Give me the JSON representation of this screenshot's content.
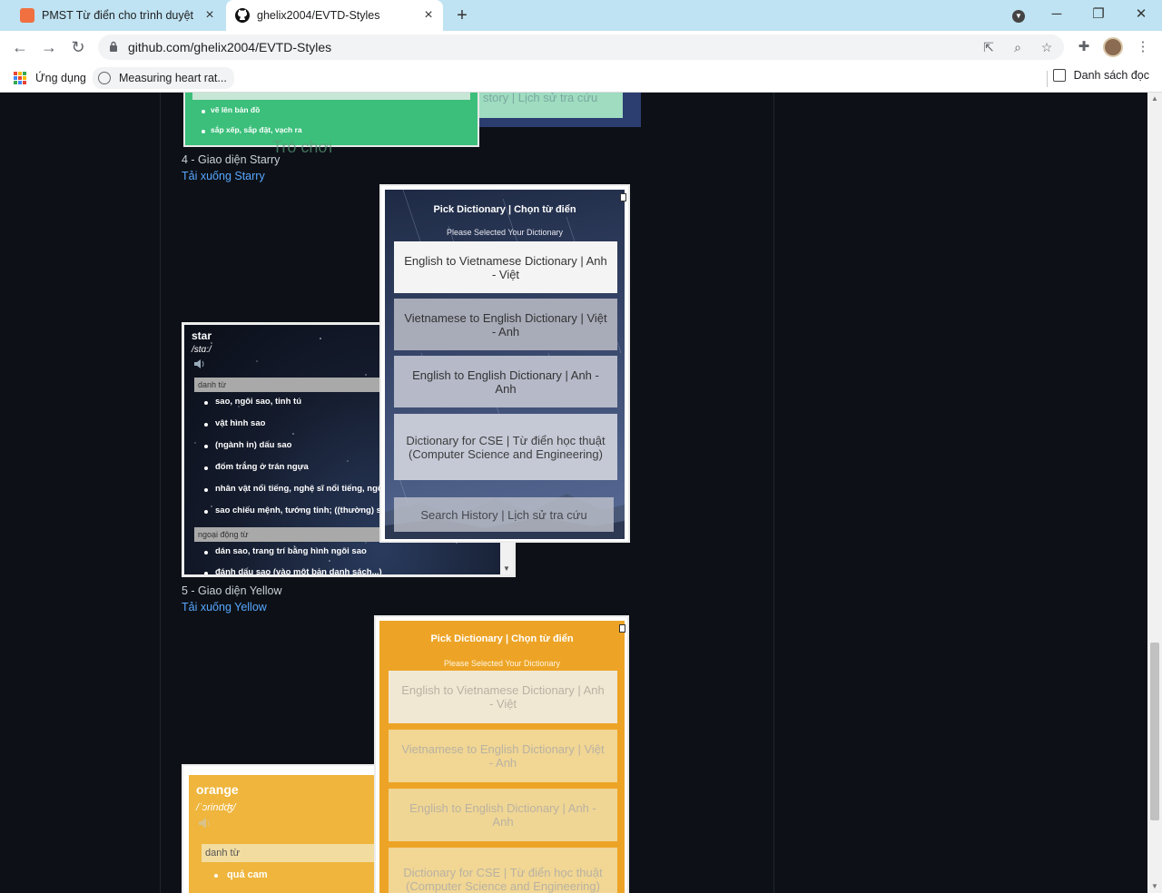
{
  "browser": {
    "tabs": [
      {
        "title": "PMST Từ điển cho trình duyệt"
      },
      {
        "title": "ghelix2004/EVTD-Styles"
      }
    ],
    "url": "github.com/ghelix2004/EVTD-Styles",
    "bookmarks": [
      {
        "label": "Ứng dụng"
      },
      {
        "label": "Measuring heart rat..."
      }
    ],
    "reading_list": "Danh sách đọc"
  },
  "green_preview": {
    "items": [
      "vẽ lên bản đồ",
      "sắp xếp, sắp đặt, vạch ra"
    ],
    "faded_text": "Trò chơi",
    "back_text": "story | Lịch sử tra cứu"
  },
  "sections": [
    {
      "heading": "4 - Giao diện Starry",
      "link": "Tải xuống Starry"
    },
    {
      "heading": "5 - Giao diện Yellow",
      "link": "Tải xuống Yellow"
    }
  ],
  "starry": {
    "word": {
      "word": "star",
      "pron": "/stɑ:/",
      "pos1": "danh từ",
      "items1": [
        "sao, ngôi sao, tinh tú",
        "vật hình sao",
        "(ngành in) dấu sao",
        "đốm trắng ở trán ngựa",
        "nhân vật nổi tiếng, nghệ sĩ nổi tiếng, ngô",
        "sao chiếu mệnh, tướng tinh; ((thường) số"
      ],
      "pos2": "ngoại động từ",
      "items2": [
        "dán sao, trang trí bằng hình ngôi sao",
        "đánh dấu sao (vào một bản danh sách...)"
      ]
    },
    "pick": {
      "title": "Pick Dictionary | Chọn từ điển",
      "subtitle": "Please Selected Your Dictionary",
      "options": [
        "English to Vietnamese Dictionary | Anh - Việt",
        "Vietnamese to English Dictionary | Việt - Anh",
        "English to English Dictionary | Anh - Anh",
        "Dictionary for CSE | Từ điển học thuật (Computer Science and Engineering)"
      ],
      "history": "Search History | Lịch sử tra cứu"
    }
  },
  "yellow": {
    "word": {
      "word": "orange",
      "pron": "/ˈɔrindʤ/",
      "pos1": "danh từ",
      "items1": [
        "quả cam"
      ]
    },
    "pick": {
      "title": "Pick Dictionary | Chọn từ điển",
      "subtitle": "Please Selected Your Dictionary",
      "options": [
        "English to Vietnamese Dictionary | Anh - Việt",
        "Vietnamese to English Dictionary | Việt - Anh",
        "English to English Dictionary | Anh - Anh",
        "Dictionary for CSE | Từ điển học thuật (Computer Science and Engineering)"
      ]
    }
  },
  "colors": {
    "page_bg": "#0d1117",
    "link": "#58a6ff",
    "tab_strip": "#bfe3f2",
    "yellow_theme": "#eda426",
    "green_theme": "#3bbf7a"
  }
}
